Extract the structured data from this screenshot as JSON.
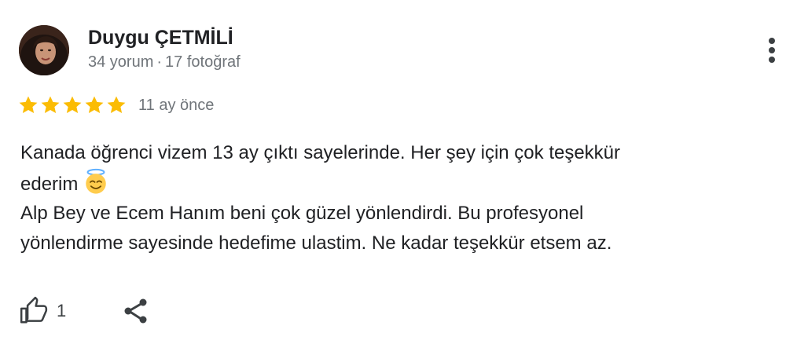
{
  "review": {
    "author": {
      "name": "Duygu ÇETMİLİ",
      "reviews_count": "34 yorum",
      "separator": "·",
      "photos_count": "17 fotoğraf"
    },
    "rating": 5,
    "max_rating": 5,
    "date": "11 ay önce",
    "text_lines": [
      "Kanada öğrenci vizem 13 ay çıktı sayelerinde. Her şey için çok teşekkür",
      "ederim",
      "Alp Bey ve Ecem Hanım beni çok güzel yönlendirdi. Bu profesyonel",
      "yönlendirme sayesinde hedefime ulastim. Ne kadar teşekkür etsem az."
    ],
    "emoji": "smiling-face-with-halo",
    "likes": "1"
  },
  "icons": {
    "more": "more-vert-icon",
    "star": "star-icon",
    "like": "thumb-up-icon",
    "share": "share-icon"
  },
  "colors": {
    "star": "#fbbc04",
    "meta_text": "#70757a",
    "text": "#202124"
  }
}
